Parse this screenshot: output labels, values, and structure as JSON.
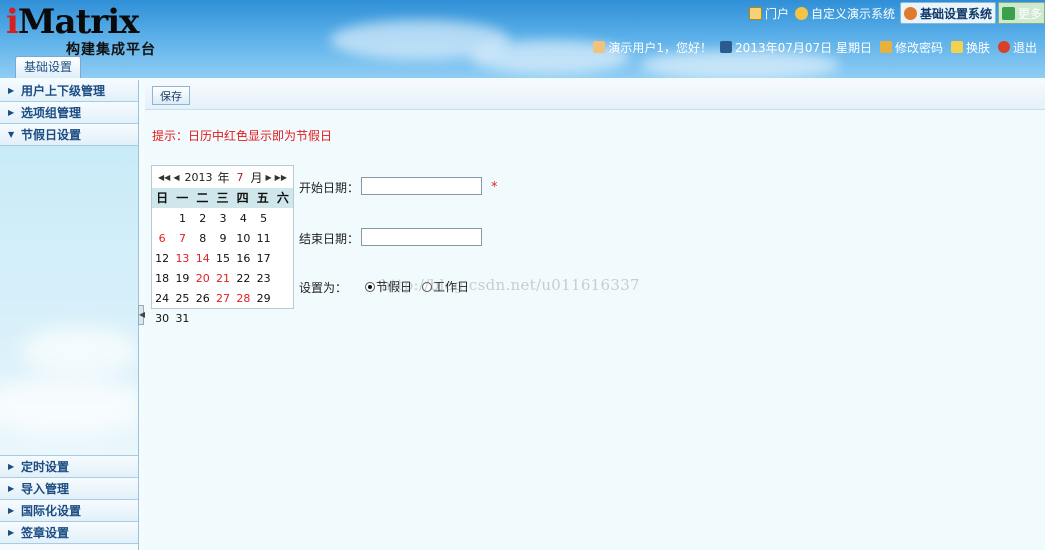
{
  "header": {
    "brand_i": "i",
    "brand_rest": "Matrix",
    "subtitle": "构建集成平台",
    "nav": [
      {
        "label": "门户",
        "icon": "home-icon",
        "active": false
      },
      {
        "label": "自定义演示系统",
        "icon": "star-icon",
        "active": false
      },
      {
        "label": "基础设置系统",
        "icon": "settings-icon",
        "active": true
      },
      {
        "label": "更多",
        "icon": "chevron-down-icon",
        "active": false
      }
    ],
    "user": {
      "greeting": "演示用户1，您好！",
      "date": "2013年07月07日 星期日",
      "change_password": "修改密码",
      "change_skin": "换肤",
      "logout": "退出"
    },
    "active_tab": "基础设置"
  },
  "sidebar": {
    "top_items": [
      {
        "label": "用户上下级管理",
        "expanded": false
      },
      {
        "label": "选项组管理",
        "expanded": false
      },
      {
        "label": "节假日设置",
        "expanded": true
      }
    ],
    "bottom_items": [
      {
        "label": "定时设置"
      },
      {
        "label": "导入管理"
      },
      {
        "label": "国际化设置"
      },
      {
        "label": "签章设置"
      }
    ]
  },
  "toolbar": {
    "save_label": "保存"
  },
  "hint": "提示：日历中红色显示即为节假日",
  "calendar": {
    "year": "2013",
    "year_label": "年",
    "month": "7",
    "month_label": "月",
    "weekdays": [
      "日",
      "一",
      "二",
      "三",
      "四",
      "五",
      "六"
    ],
    "lead_blanks": 1,
    "days": [
      {
        "d": "1",
        "h": false
      },
      {
        "d": "2",
        "h": false
      },
      {
        "d": "3",
        "h": false
      },
      {
        "d": "4",
        "h": false
      },
      {
        "d": "5",
        "h": false
      },
      {
        "d": "6",
        "h": true
      },
      {
        "d": "7",
        "h": true
      },
      {
        "d": "8",
        "h": false
      },
      {
        "d": "9",
        "h": false
      },
      {
        "d": "10",
        "h": false
      },
      {
        "d": "11",
        "h": false
      },
      {
        "d": "12",
        "h": false
      },
      {
        "d": "13",
        "h": true
      },
      {
        "d": "14",
        "h": true
      },
      {
        "d": "15",
        "h": false
      },
      {
        "d": "16",
        "h": false
      },
      {
        "d": "17",
        "h": false
      },
      {
        "d": "18",
        "h": false
      },
      {
        "d": "19",
        "h": false
      },
      {
        "d": "20",
        "h": true
      },
      {
        "d": "21",
        "h": true
      },
      {
        "d": "22",
        "h": false
      },
      {
        "d": "23",
        "h": false
      },
      {
        "d": "24",
        "h": false
      },
      {
        "d": "25",
        "h": false
      },
      {
        "d": "26",
        "h": false
      },
      {
        "d": "27",
        "h": true
      },
      {
        "d": "28",
        "h": true
      },
      {
        "d": "29",
        "h": false
      },
      {
        "d": "30",
        "h": false
      },
      {
        "d": "31",
        "h": false
      }
    ]
  },
  "form": {
    "start_label": "开始日期：",
    "start_value": "",
    "end_label": "结束日期：",
    "end_value": "",
    "set_as_label": "设置为：",
    "option_holiday": "节假日",
    "option_workday": "工作日",
    "selected": "holiday",
    "required_mark": "*"
  },
  "watermark": "http://blog.csdn.net/u011616337",
  "colors": {
    "accent": "#2f8fd6",
    "holiday": "#e02020",
    "hint": "#e31a1a"
  }
}
